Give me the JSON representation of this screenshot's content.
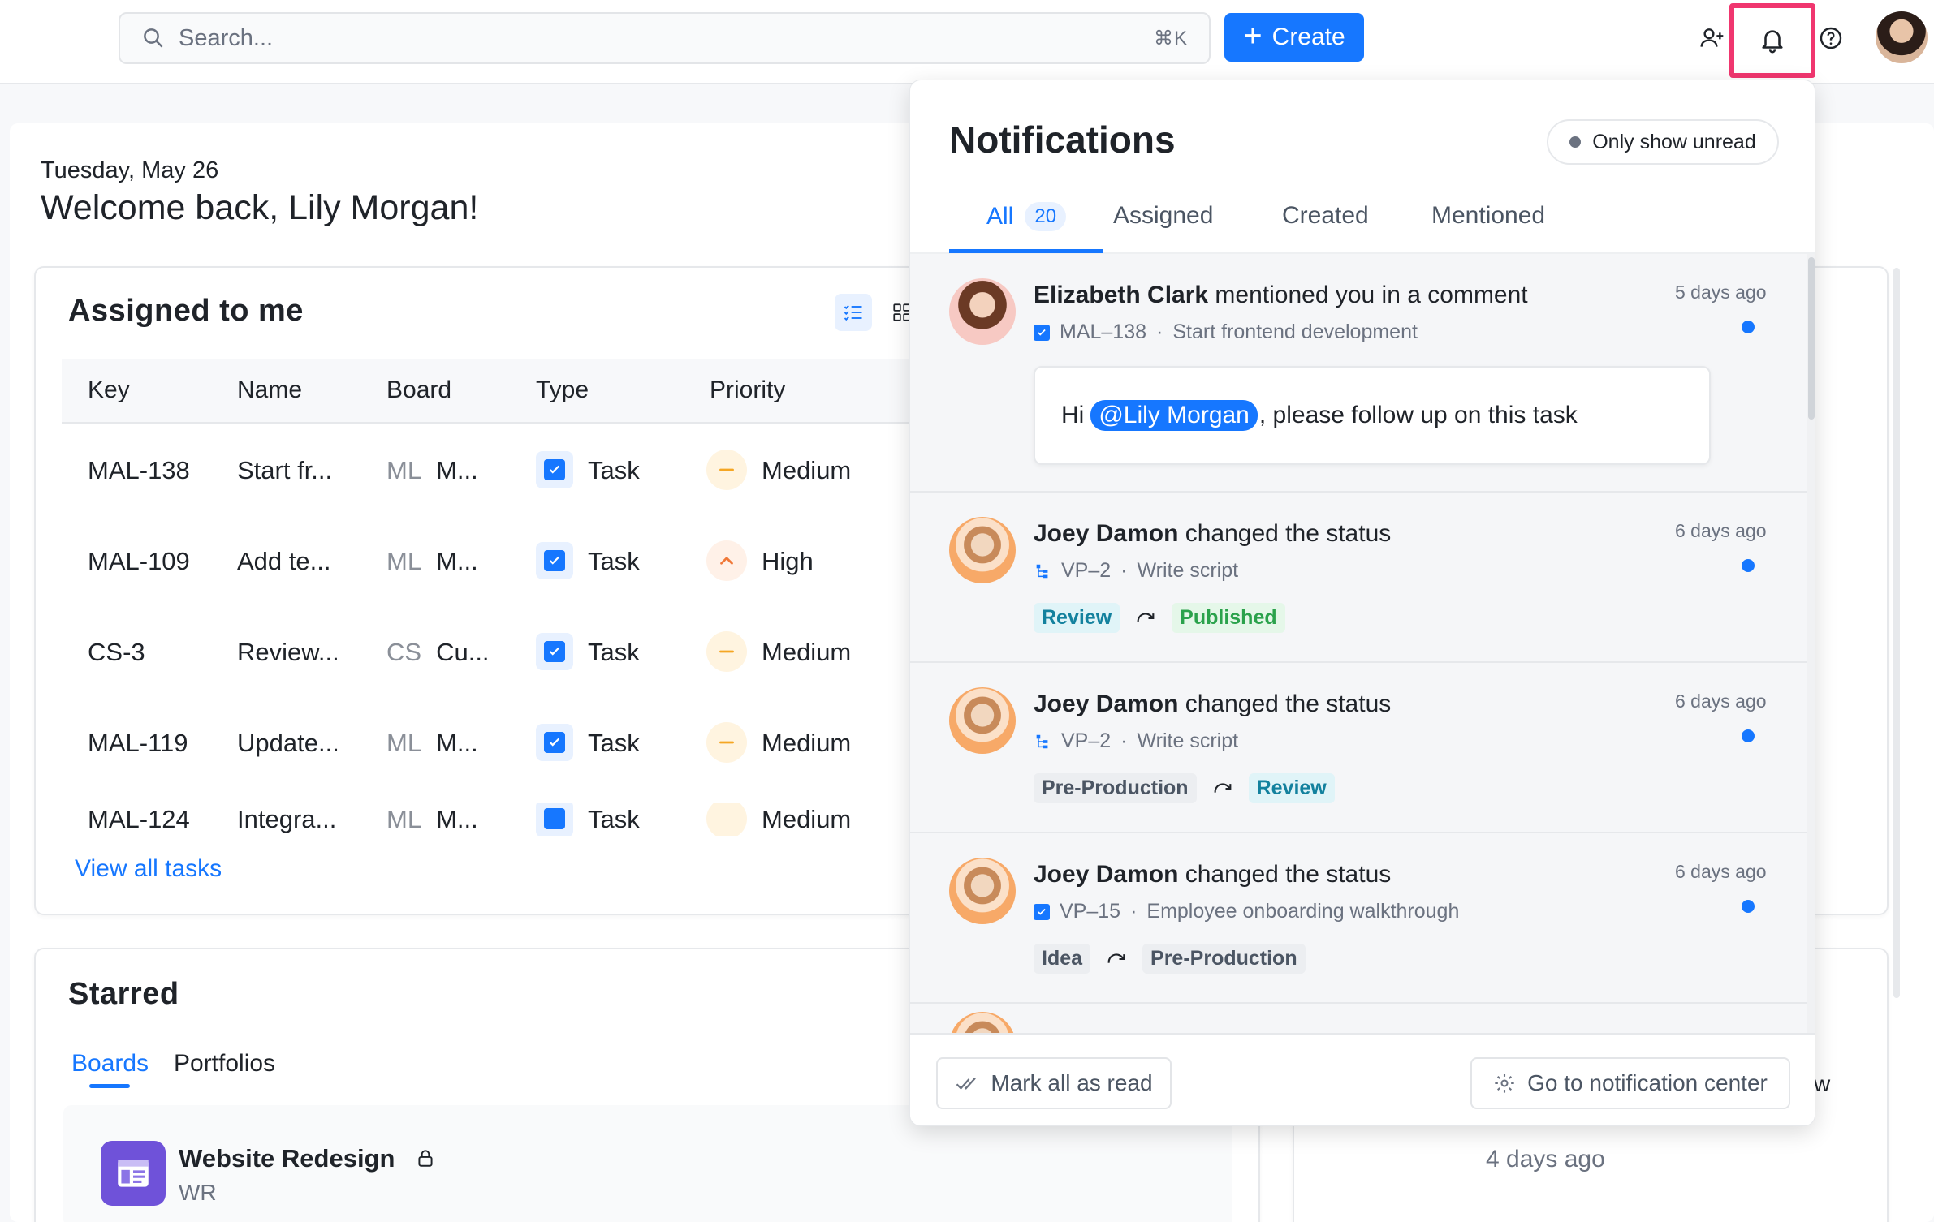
{
  "topbar": {
    "search_placeholder": "Search...",
    "search_shortcut": "⌘K",
    "create_label": "Create",
    "icons": [
      "search-icon",
      "add-user-icon",
      "bell-icon",
      "help-icon",
      "avatar"
    ],
    "accent_color": "#1677ff",
    "highlight_color": "#f0366f"
  },
  "home": {
    "date": "Tuesday, May 26",
    "welcome": "Welcome back, Lily Morgan!"
  },
  "assigned": {
    "title": "Assigned to me",
    "columns": [
      "Key",
      "Name",
      "Board",
      "Type",
      "Priority"
    ],
    "rows": [
      {
        "key": "MAL-138",
        "name": "Start fr...",
        "board_key": "ML",
        "board": "M...",
        "type": "Task",
        "priority": "Medium"
      },
      {
        "key": "MAL-109",
        "name": "Add te...",
        "board_key": "ML",
        "board": "M...",
        "type": "Task",
        "priority": "High"
      },
      {
        "key": "CS-3",
        "name": "Review...",
        "board_key": "CS",
        "board": "Cu...",
        "type": "Task",
        "priority": "Medium"
      },
      {
        "key": "MAL-119",
        "name": "Update...",
        "board_key": "ML",
        "board": "M...",
        "type": "Task",
        "priority": "Medium"
      },
      {
        "key": "MAL-124",
        "name": "Integra...",
        "board_key": "ML",
        "board": "M...",
        "type": "Task",
        "priority": "Medium"
      }
    ],
    "view_all": "View all tasks"
  },
  "starred": {
    "title": "Starred",
    "tabs": [
      "Boards",
      "Portfolios"
    ],
    "active_tab": "Boards",
    "board": {
      "title": "Website Redesign",
      "key": "WR"
    },
    "right_time": "4 days ago",
    "right_partial": "w"
  },
  "notifications": {
    "title": "Notifications",
    "only_unread": "Only show unread",
    "tabs": [
      {
        "label": "All",
        "count": "20"
      },
      {
        "label": "Assigned"
      },
      {
        "label": "Created"
      },
      {
        "label": "Mentioned"
      }
    ],
    "items": [
      {
        "actor": "Elizabeth Clark",
        "action": "mentioned you in a comment",
        "time": "5 days ago",
        "key": "MAL–138",
        "task": "Start frontend development",
        "quote_prefix": "Hi",
        "mention": "@Lily Morgan",
        "quote_suffix": ", please follow up on this task"
      },
      {
        "actor": "Joey Damon",
        "action": "changed the status",
        "time": "6 days ago",
        "key": "VP–2",
        "task": "Write script",
        "from": "Review",
        "to": "Published"
      },
      {
        "actor": "Joey Damon",
        "action": "changed the status",
        "time": "6 days ago",
        "key": "VP–2",
        "task": "Write script",
        "from": "Pre-Production",
        "to": "Review"
      },
      {
        "actor": "Joey Damon",
        "action": "changed the status",
        "time": "6 days ago",
        "key": "VP–15",
        "task": "Employee onboarding walkthrough",
        "from": "Idea",
        "to": "Pre-Production"
      }
    ],
    "mark_all_read": "Mark all as read",
    "go_center": "Go to notification center"
  }
}
